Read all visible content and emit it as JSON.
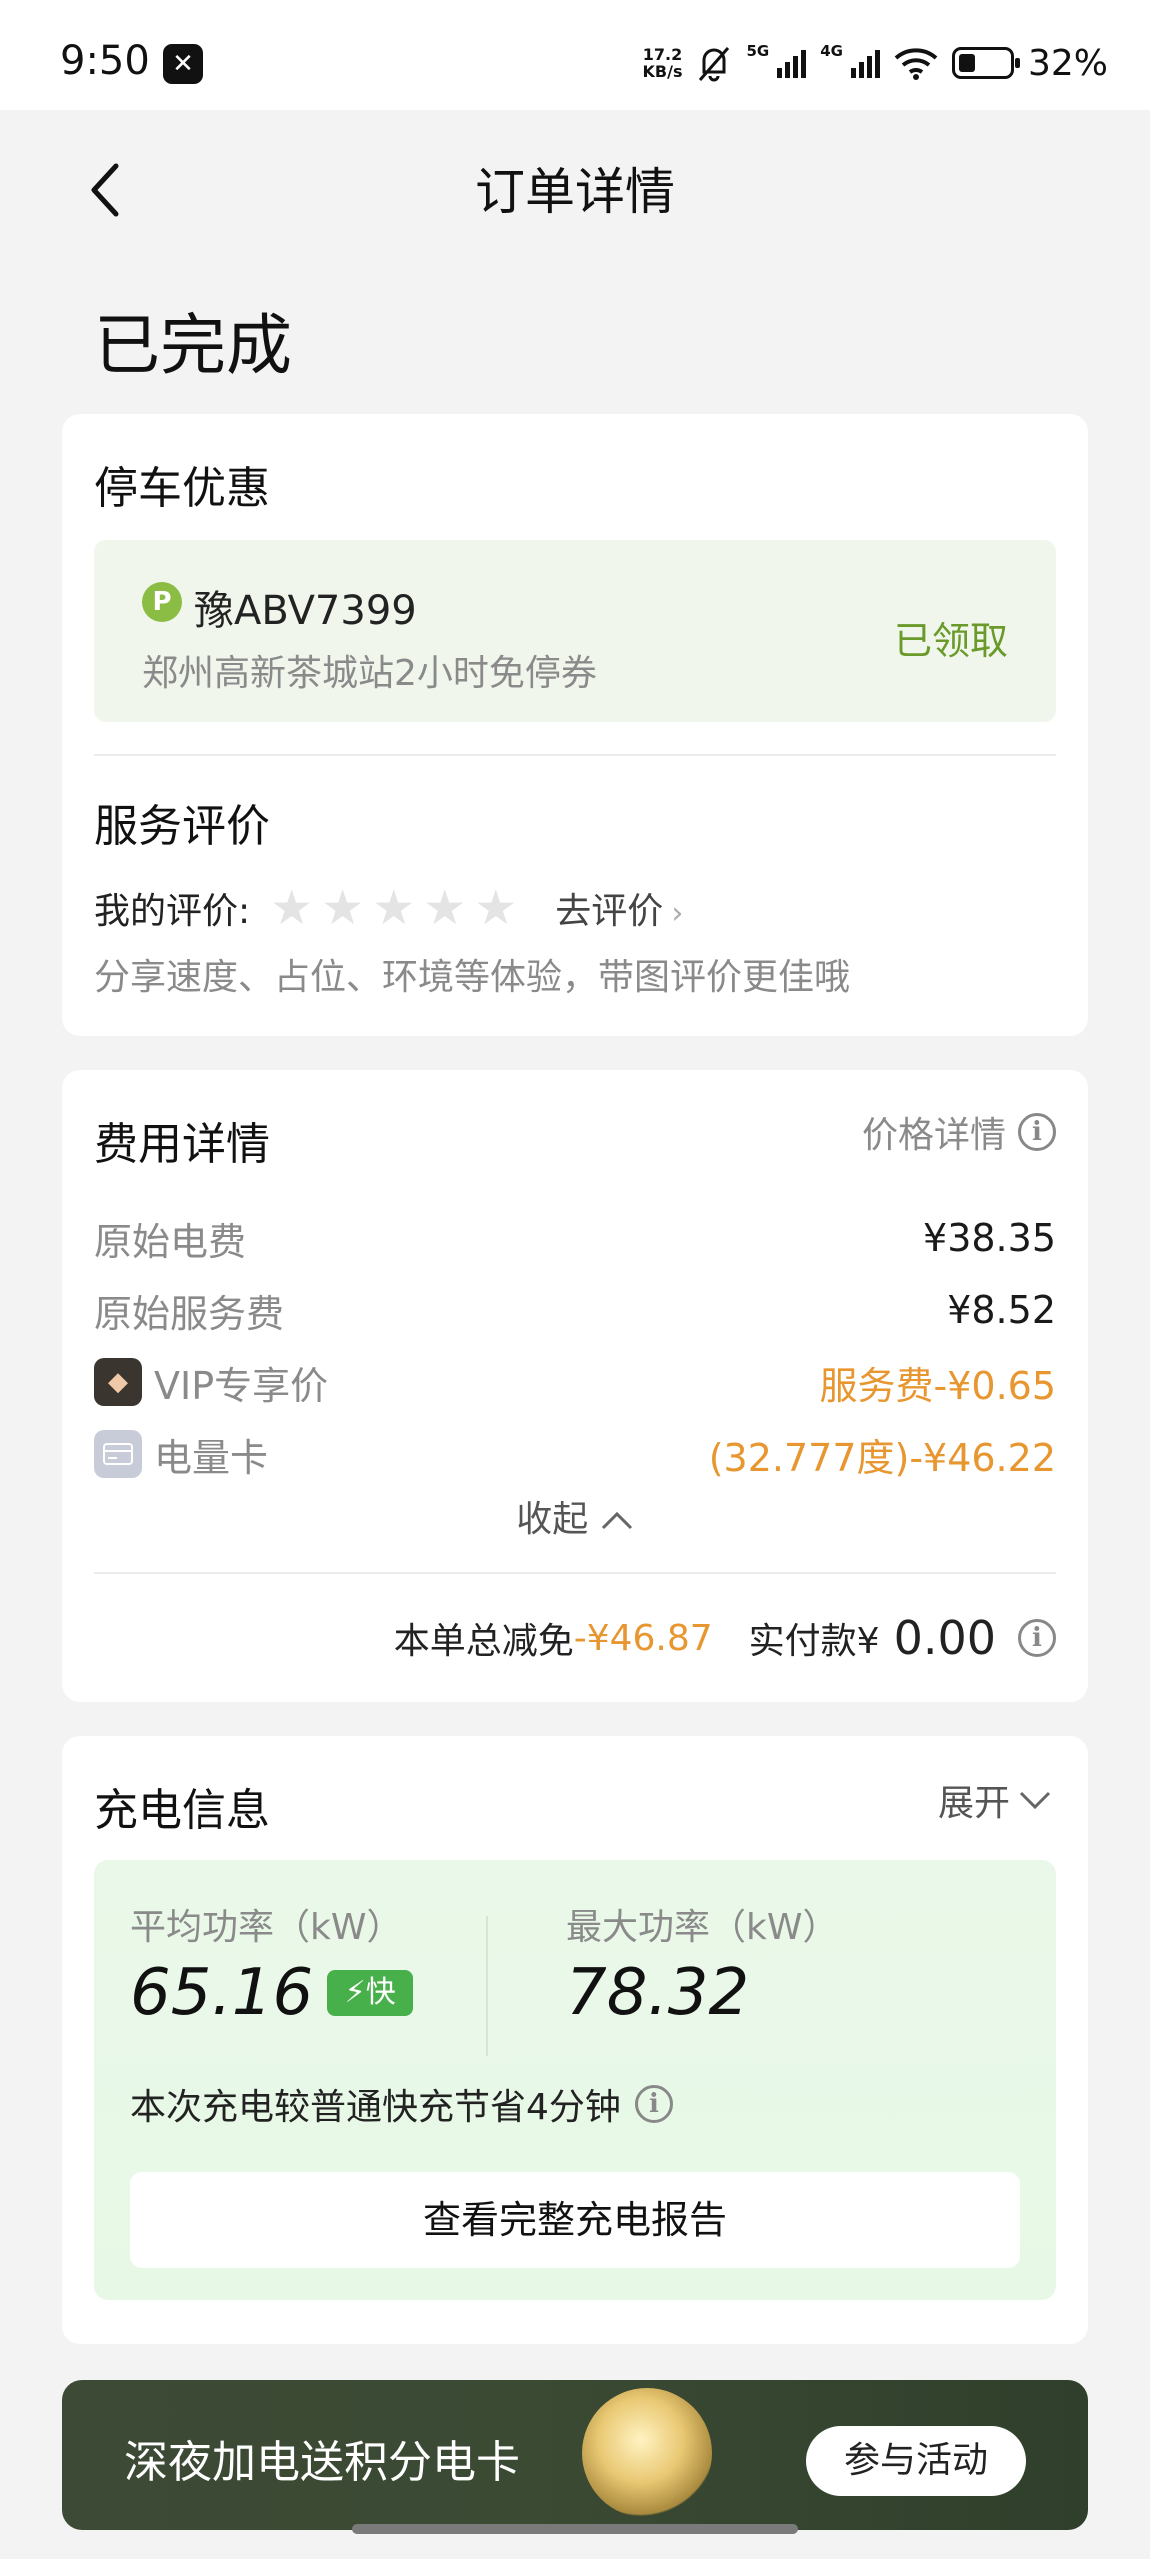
{
  "status_bar": {
    "time": "9:50",
    "net_speed_value": "17.2",
    "net_speed_unit": "KB/s",
    "sig1": "5G",
    "sig2": "4G",
    "battery": "32%"
  },
  "nav": {
    "title": "订单详情"
  },
  "order_status": "已完成",
  "parking": {
    "title": "停车优惠",
    "badge": "P",
    "plate": "豫ABV7399",
    "desc": "郑州高新茶城站2小时免停券",
    "status": "已领取"
  },
  "review": {
    "title": "服务评价",
    "my_label": "我的评价:",
    "stars": 0,
    "action": "去评价",
    "hint": "分享速度、占位、环境等体验，带图评价更佳哦"
  },
  "fees": {
    "title": "费用详情",
    "price_detail": "价格详情",
    "items": [
      {
        "label": "原始电费",
        "value": "¥38.35"
      },
      {
        "label": "原始服务费",
        "value": "¥8.52"
      },
      {
        "label": "VIP专享价",
        "value": "服务费-¥0.65"
      },
      {
        "label": "电量卡",
        "value": "(32.777度)-¥46.22"
      }
    ],
    "collapse": "收起",
    "discount_label": "本单总减免",
    "discount_value": "-¥46.87",
    "paid_label": "实付款¥",
    "paid_value": "0.00"
  },
  "charging": {
    "title": "充电信息",
    "expand": "展开",
    "avg_label": "平均功率（kW）",
    "avg_value": "65.16",
    "fast_tag": "快",
    "max_label": "最大功率（kW）",
    "max_value": "78.32",
    "saving": "本次充电较普通快充节省4分钟",
    "report_button": "查看完整充电报告"
  },
  "banner": {
    "text": "深夜加电送积分电卡",
    "button": "参与活动"
  }
}
